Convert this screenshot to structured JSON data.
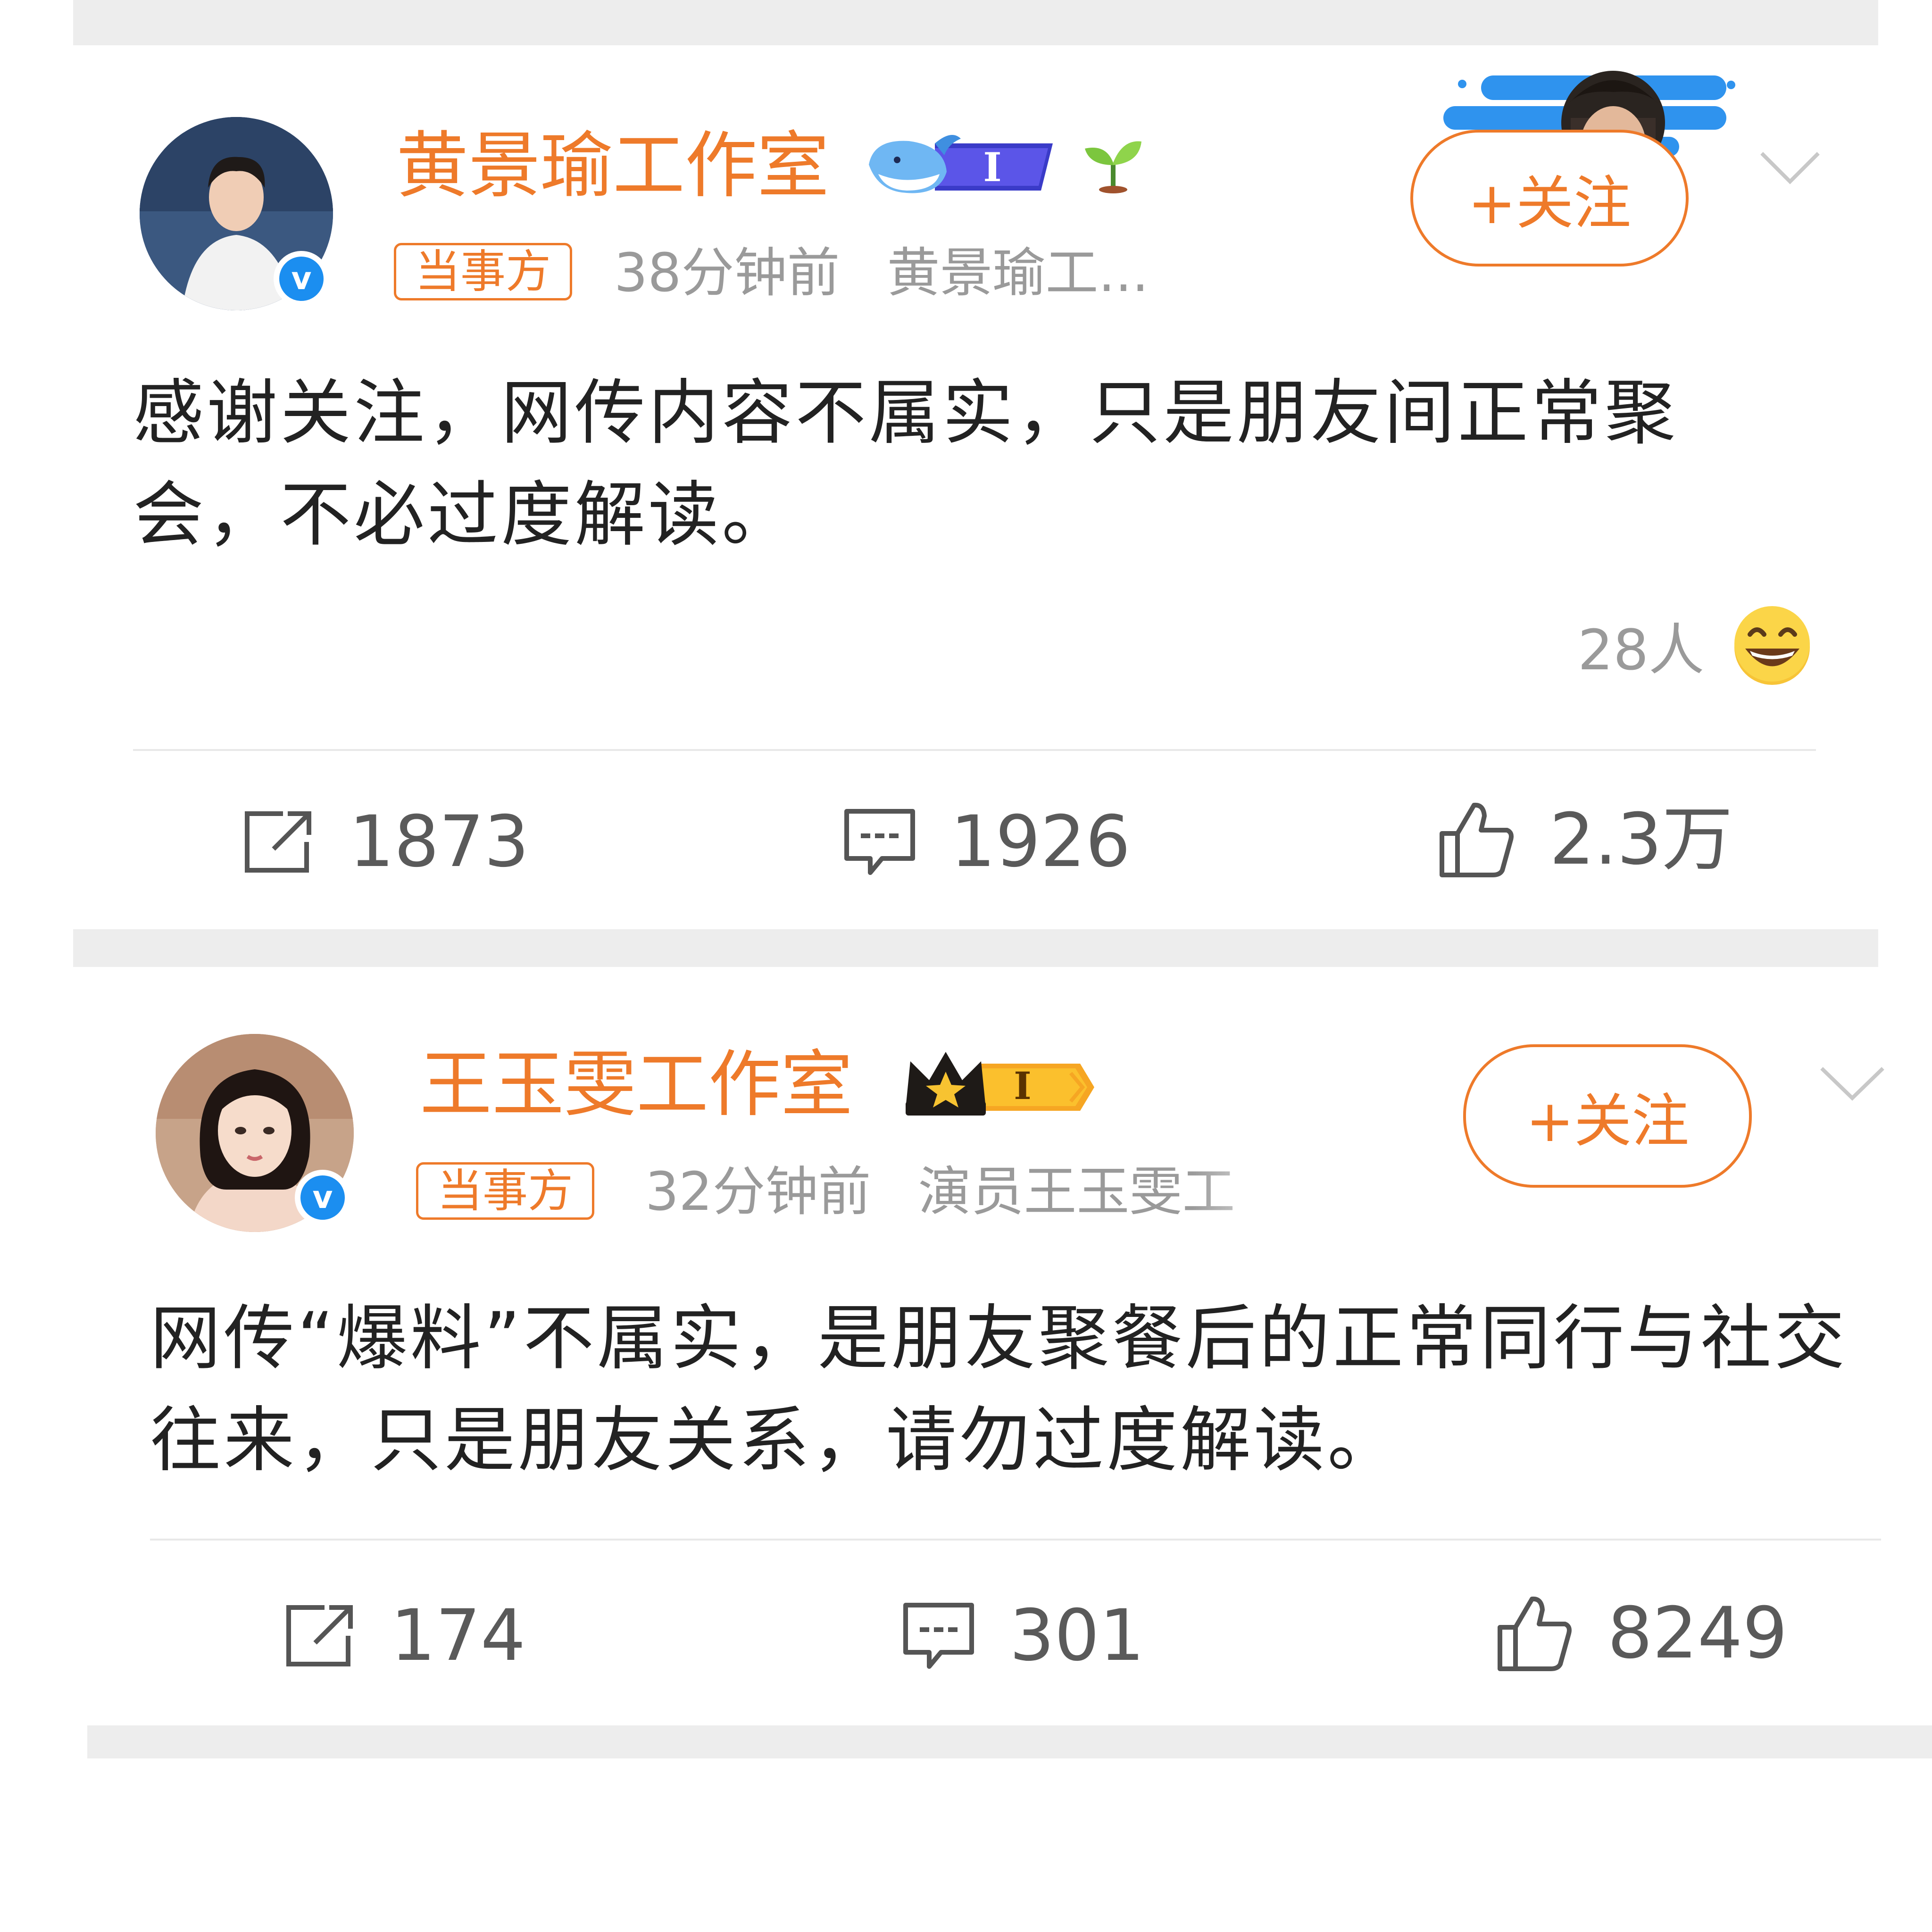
{
  "colors": {
    "accent": "#ee7a2a",
    "verified": "#1b8ef0",
    "muted": "#9a9a9a",
    "text": "#222222",
    "separator": "#ededed"
  },
  "posts": [
    {
      "author": "黄景瑜工作室",
      "member_badge": "I",
      "tag": "当事方",
      "time": "38分钟前",
      "source": "黄景瑜工...",
      "follow_label": "+关注",
      "content": "感谢关注，网传内容不属实，只是朋友间正常聚会，不必过度解读。",
      "reaction_text": "28人",
      "reaction_icon": "grinning-emoji-icon",
      "actions": {
        "repost": "1873",
        "comment": "1926",
        "like": "2.3万"
      }
    },
    {
      "author": "王玉雯工作室",
      "member_badge": "I",
      "tag": "当事方",
      "time": "32分钟前",
      "source": "演员王玉雯工",
      "follow_label": "+关注",
      "content": "网传“爆料”不属实，是朋友聚餐后的正常同行与社交往来，只是朋友关系，请勿过度解读。",
      "actions": {
        "repost": "174",
        "comment": "301",
        "like": "8249"
      }
    }
  ]
}
